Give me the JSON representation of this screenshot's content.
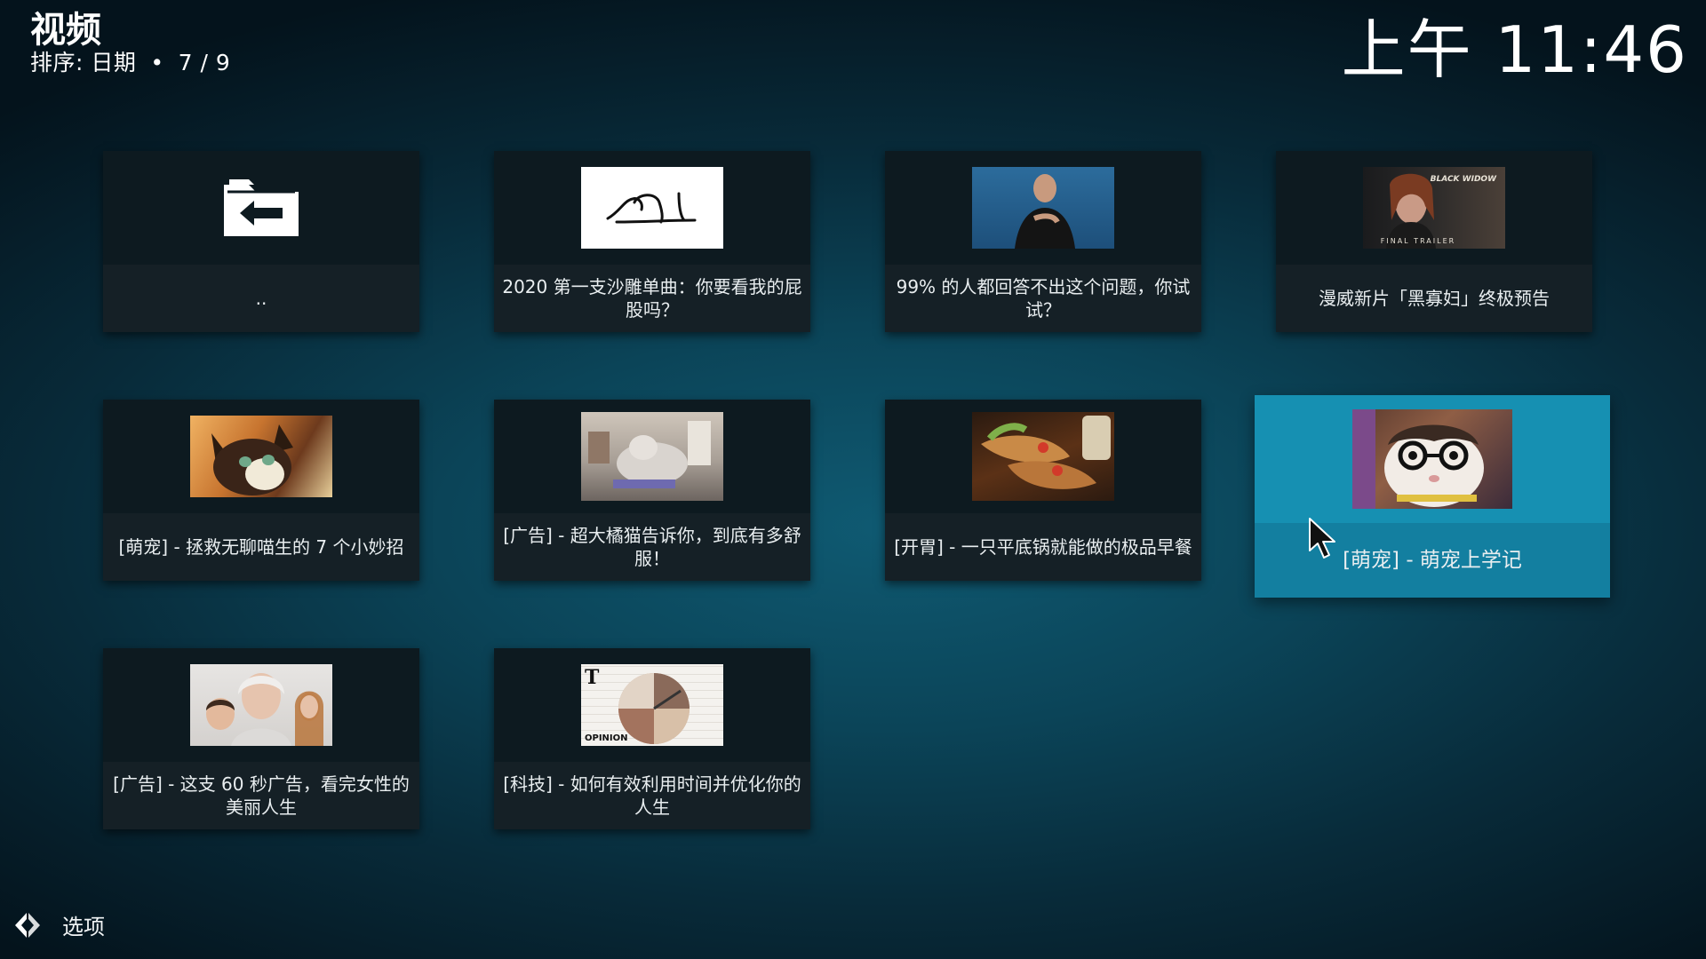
{
  "header": {
    "title": "视频",
    "sort_label": "排序: 日期",
    "position": "7 / 9",
    "clock": "上午 11:46"
  },
  "items": [
    {
      "label": "..",
      "thumb": "folder-back-icon"
    },
    {
      "label": "2020 第一支沙雕单曲：你要看我的屁股吗？",
      "thumb": "line-sketch"
    },
    {
      "label": "99% 的人都回答不出这个问题，你试试？",
      "thumb": "man-portrait"
    },
    {
      "label": "漫威新片「黑寡妇」终极预告",
      "thumb": "black-widow-trailer",
      "thumb_text": [
        "BLACK WIDOW",
        "FINAL TRAILER"
      ]
    },
    {
      "label": "[萌宠] - 拯救无聊喵生的 7 个小妙招",
      "thumb": "cat"
    },
    {
      "label": "[广告] - 超大橘猫告诉你，到底有多舒服！",
      "thumb": "giant-cat-room"
    },
    {
      "label": "[开胃] - 一只平底锅就能做的极品早餐",
      "thumb": "wraps-food"
    },
    {
      "label": "[萌宠] - 萌宠上学记",
      "thumb": "guinea-pig-glasses",
      "focused": true
    },
    {
      "label": "[广告] - 这支 60 秒广告，看完女性的美丽人生",
      "thumb": "three-generations"
    },
    {
      "label": "[科技] - 如何有效利用时间并优化你的人生",
      "thumb": "clock-illustration",
      "thumb_text": [
        "T",
        "OPINION"
      ]
    }
  ],
  "footer": {
    "options_label": "选项"
  },
  "colors": {
    "focus": "#1690b2",
    "tile": "#0e1a20"
  }
}
